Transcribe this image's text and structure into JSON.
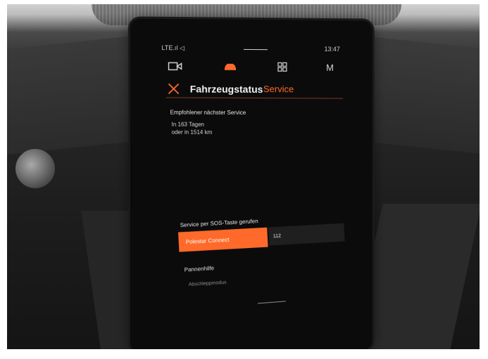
{
  "status_bar": {
    "network": "LTE.ıl ◁",
    "time": "13:47"
  },
  "top_nav": {
    "items": [
      {
        "name": "camera",
        "icon": "camera-icon"
      },
      {
        "name": "car",
        "icon": "car-icon",
        "active": true
      },
      {
        "name": "apps",
        "icon": "grid-icon"
      },
      {
        "name": "profile",
        "label": "M"
      }
    ]
  },
  "header": {
    "title": "Fahrzeugstatus",
    "active_tab": "Service"
  },
  "recommended_service": {
    "title": "Empfohlener nächster Service",
    "line1": "In 163 Tagen",
    "line2": "oder in 1514 km"
  },
  "sos": {
    "title": "Service per SOS-Taste gerufen",
    "button_label": "Polestar Connect",
    "number": "112"
  },
  "breakdown": {
    "title": "Pannenhilfe",
    "item": "Abschleppmodus"
  },
  "colors": {
    "accent": "#ff6a2a",
    "background": "#0b0b0c"
  }
}
